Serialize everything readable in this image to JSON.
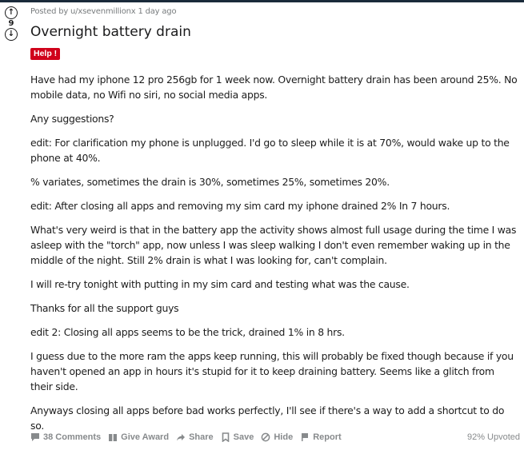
{
  "post": {
    "score": "9",
    "meta": "Posted by u/xsevenmillionx 1 day ago",
    "title": "Overnight battery drain",
    "flair": "Help !",
    "paragraphs": [
      "Have had my iphone 12 pro 256gb for 1 week now. Overnight battery drain has been around 25%. No mobile data, no Wifi no siri, no social media apps.",
      "Any suggestions?",
      "edit: For clarification my phone is unplugged. I'd go to sleep while it is at 70%, would wake up to the phone at 40%.",
      "% variates, sometimes the drain is 30%, sometimes 25%, sometimes 20%.",
      "edit: After closing all apps and removing my sim card my iphone drained 2% In 7 hours.",
      "What's very weird is that in the battery app the activity shows almost full usage during the time I was asleep with the \"torch\" app, now unless I was sleep walking I don't even remember waking up in the middle of the night. Still 2% drain is what I was looking for, can't complain.",
      "I will re-try tonight with putting in my sim card and testing what was the cause.",
      "Thanks for all the support guys",
      "edit 2: Closing all apps seems to be the trick, drained 1% in 8 hrs.",
      "I guess due to the more ram the apps keep running, this will probably be fixed though because if you haven't opened an app in hours it's stupid for it to keep draining battery. Seems like a glitch from their side.",
      "Anyways closing all apps before bad works perfectly, I'll see if there's a way to add a shortcut to do so."
    ]
  },
  "footer": {
    "comments": "38 Comments",
    "award": "Give Award",
    "share": "Share",
    "save": "Save",
    "hide": "Hide",
    "report": "Report",
    "upvoted": "92% Upvoted"
  },
  "icons": {
    "upvote": "↑",
    "downvote": "↓",
    "comment": "comment-icon",
    "award": "gift-icon",
    "share": "share-arrow-icon",
    "save": "bookmark-icon",
    "hide": "hide-icon",
    "report": "flag-icon"
  },
  "colors": {
    "flair": "#d0021b",
    "meta": "#787c7e",
    "footer": "#878a8c"
  }
}
